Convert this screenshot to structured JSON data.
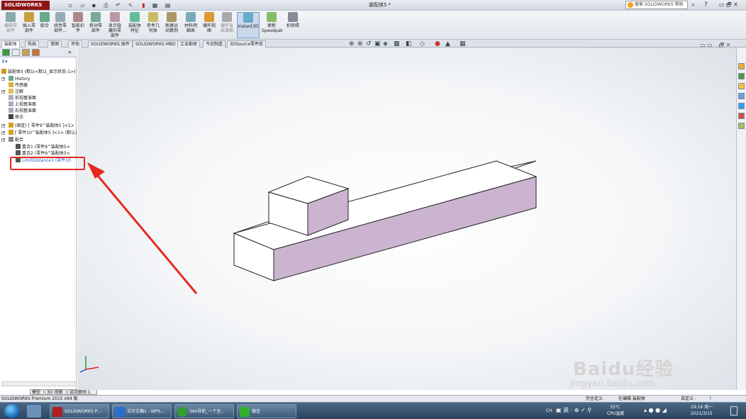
{
  "app": {
    "brand": "SOLIDWORKS",
    "doc_title": "装配体5 *"
  },
  "titlebar": {
    "search_placeholder": "搜索 SOLIDWORKS 帮助",
    "help": "?",
    "win_controls": "▭ 🗗 ✕"
  },
  "command_manager": {
    "buttons": [
      {
        "label": "编辑零\n部件",
        "icon": "edit-component-icon",
        "disabled": true
      },
      {
        "label": "插入零\n部件",
        "icon": "insert-component-icon",
        "disabled": false
      },
      {
        "label": "配合",
        "icon": "mate-icon",
        "disabled": false
      },
      {
        "label": "线性零\n部件...",
        "icon": "linear-pattern-icon",
        "disabled": false
      },
      {
        "label": "智能扣\n件",
        "icon": "smart-fastener-icon",
        "disabled": false
      },
      {
        "label": "移动零\n部件",
        "icon": "move-component-icon",
        "disabled": false
      },
      {
        "label": "显示隐\n藏的零\n部件",
        "icon": "show-hidden-icon",
        "disabled": false
      },
      {
        "label": "装配体\n特征",
        "icon": "assembly-feature-icon",
        "disabled": false
      },
      {
        "label": "参考几\n何体",
        "icon": "reference-geometry-icon",
        "disabled": false
      },
      {
        "label": "新建运\n动算例",
        "icon": "motion-study-icon",
        "disabled": false
      },
      {
        "label": "材料明\n细表",
        "icon": "bom-icon",
        "disabled": false
      },
      {
        "label": "爆炸视\n图",
        "icon": "exploded-view-icon",
        "disabled": false
      },
      {
        "label": "爆炸直\n线草图",
        "icon": "explode-line-icon",
        "disabled": true
      },
      {
        "label": "Instant3D",
        "icon": "instant3d-icon",
        "disabled": false,
        "active": true
      },
      {
        "label": "更新\nSpeedpak",
        "icon": "speedpak-icon",
        "disabled": false
      },
      {
        "label": "拍快照",
        "icon": "snapshot-icon",
        "disabled": false
      }
    ]
  },
  "tabs": [
    "装配体",
    "布局",
    "草图",
    "评估",
    "SOLIDWORKS 插件",
    "SOLIDWORKS MBD",
    "工业勘探",
    "今日制造",
    "3DSource零件库"
  ],
  "feature_tree": {
    "root": "装配体5 (默认<默认_显示状态-1>)",
    "items": [
      "History",
      "传感器",
      "注解",
      "前视基准面",
      "上视基准面",
      "右视基准面",
      "原点",
      "(固定) [ 零件9^装配体5 ]<1>",
      "[ 零件10^装配体5 ]<1> (默认)",
      "配合",
      "重合1 (零件9^装配体5<",
      "重合2 (零件9^装配体5<",
      "LimitDistance1 (零件10"
    ]
  },
  "panel_tabs_bottom": [
    "模型",
    "3D 视图",
    "运动算例 1"
  ],
  "status_bar": {
    "left": "SOLIDWORKS Premium 2015 x64 版",
    "status": "完全定义",
    "editing": "在编辑 装配体",
    "custom": "自定义 -"
  },
  "taskbar": {
    "tasks": [
      "SOLIDWORKS P...",
      "文字文稿1 - WPS...",
      "360导航_一个主...",
      "微信"
    ],
    "tray_lang": "CH",
    "temperature": "35℃",
    "cpu_label": "CPU温度",
    "time": "19:16 周一",
    "date": "2021/3/15"
  },
  "watermark": {
    "brand": "Baidu经验",
    "url": "jingyan.baidu.com"
  },
  "colors": {
    "accent_red": "#e8281e",
    "part_face": "#cbb4cf",
    "selection_blue": "#1e5fbd"
  }
}
